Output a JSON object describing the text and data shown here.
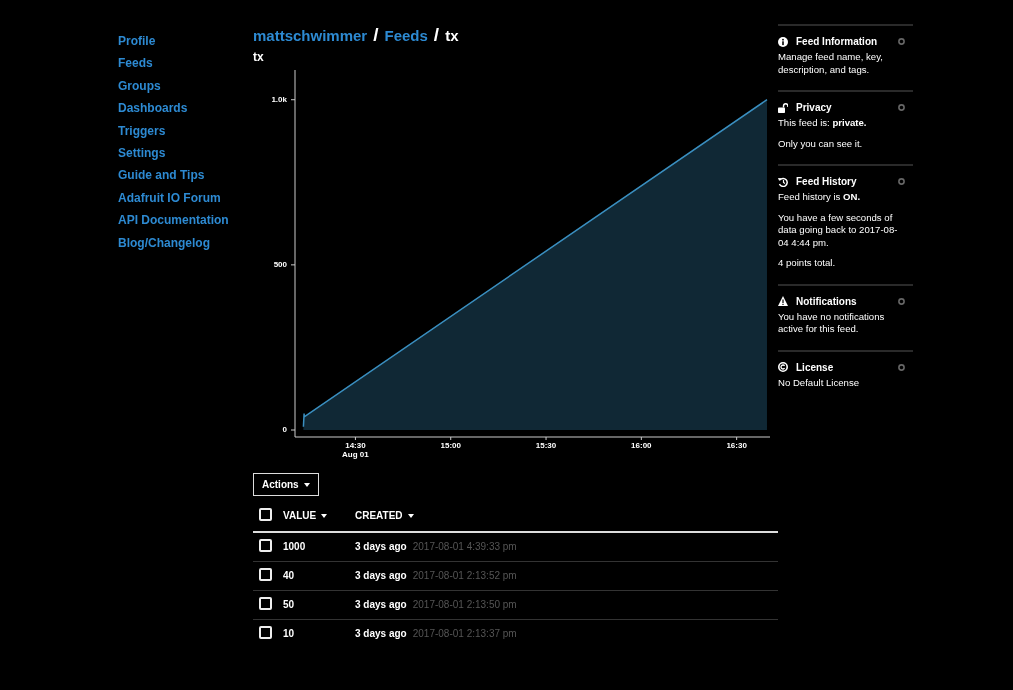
{
  "sidebar": {
    "items": [
      {
        "label": "Profile"
      },
      {
        "label": "Feeds"
      },
      {
        "label": "Groups"
      },
      {
        "label": "Dashboards"
      },
      {
        "label": "Triggers"
      },
      {
        "label": "Settings"
      },
      {
        "label": "Guide and Tips"
      },
      {
        "label": "Adafruit IO Forum"
      },
      {
        "label": "API Documentation"
      },
      {
        "label": "Blog/Changelog"
      }
    ]
  },
  "breadcrumb": [
    {
      "label": "mattschwimmer",
      "kind": "link"
    },
    {
      "label": "/",
      "kind": "separator"
    },
    {
      "label": "Feeds",
      "kind": "link"
    },
    {
      "label": "/",
      "kind": "separator"
    },
    {
      "label": "tx",
      "kind": "current"
    }
  ],
  "feed_title": "tx",
  "chart": {
    "chart_data": {
      "type": "area",
      "x": [
        14.2269,
        14.2306,
        14.2311,
        16.6592
      ],
      "series": [
        {
          "color": "#3a8fc0",
          "values": [
            10,
            50,
            40,
            1000
          ]
        }
      ],
      "xlim": [
        14.183,
        16.675
      ],
      "ylim": [
        0,
        1090
      ],
      "xticks": [
        {
          "value": 14.5,
          "label": "14:30 Aug 01"
        },
        {
          "value": 15,
          "label": "15:00"
        },
        {
          "value": 15.5,
          "label": "15:30"
        },
        {
          "value": 16,
          "label": "16:00"
        },
        {
          "value": 16.5,
          "label": "16:30"
        }
      ],
      "yticks": [
        0,
        500,
        {
          "value": 1000,
          "label": "1.0k"
        }
      ]
    }
  },
  "actions_button": "Actions",
  "table": {
    "header_checkbox": {
      "checked": false
    },
    "columns": [
      "VALUE",
      "CREATED"
    ],
    "rows": [
      {
        "checked": false,
        "value": "1000",
        "age": "3 days ago",
        "created": "2017-08-01 4:39:33 pm"
      },
      {
        "checked": false,
        "value": "40",
        "age": "3 days ago",
        "created": "2017-08-01 2:13:52 pm"
      },
      {
        "checked": false,
        "value": "50",
        "age": "3 days ago",
        "created": "2017-08-01 2:13:50 pm"
      },
      {
        "checked": false,
        "value": "10",
        "age": "3 days ago",
        "created": "2017-08-01 2:13:37 pm"
      }
    ]
  },
  "info_panel": {
    "sections": [
      {
        "kind": "info",
        "title": "Feed Information",
        "paragraphs": [
          "Manage feed name, key, description, and tags."
        ]
      },
      {
        "kind": "privacy",
        "title": "Privacy",
        "paragraphs": [
          "This feed is: **private.**",
          "Only you can see it."
        ]
      },
      {
        "kind": "history",
        "title": "Feed History",
        "paragraphs": [
          "Feed history is **ON.**",
          "You have a few seconds of data going back to 2017-08-04 4:44 pm.",
          "4 points total."
        ]
      },
      {
        "kind": "notifications",
        "title": "Notifications",
        "paragraphs": [
          "You have no notifications active for this feed."
        ]
      },
      {
        "kind": "license",
        "title": "License",
        "paragraphs": [
          "No Default License"
        ]
      }
    ]
  }
}
